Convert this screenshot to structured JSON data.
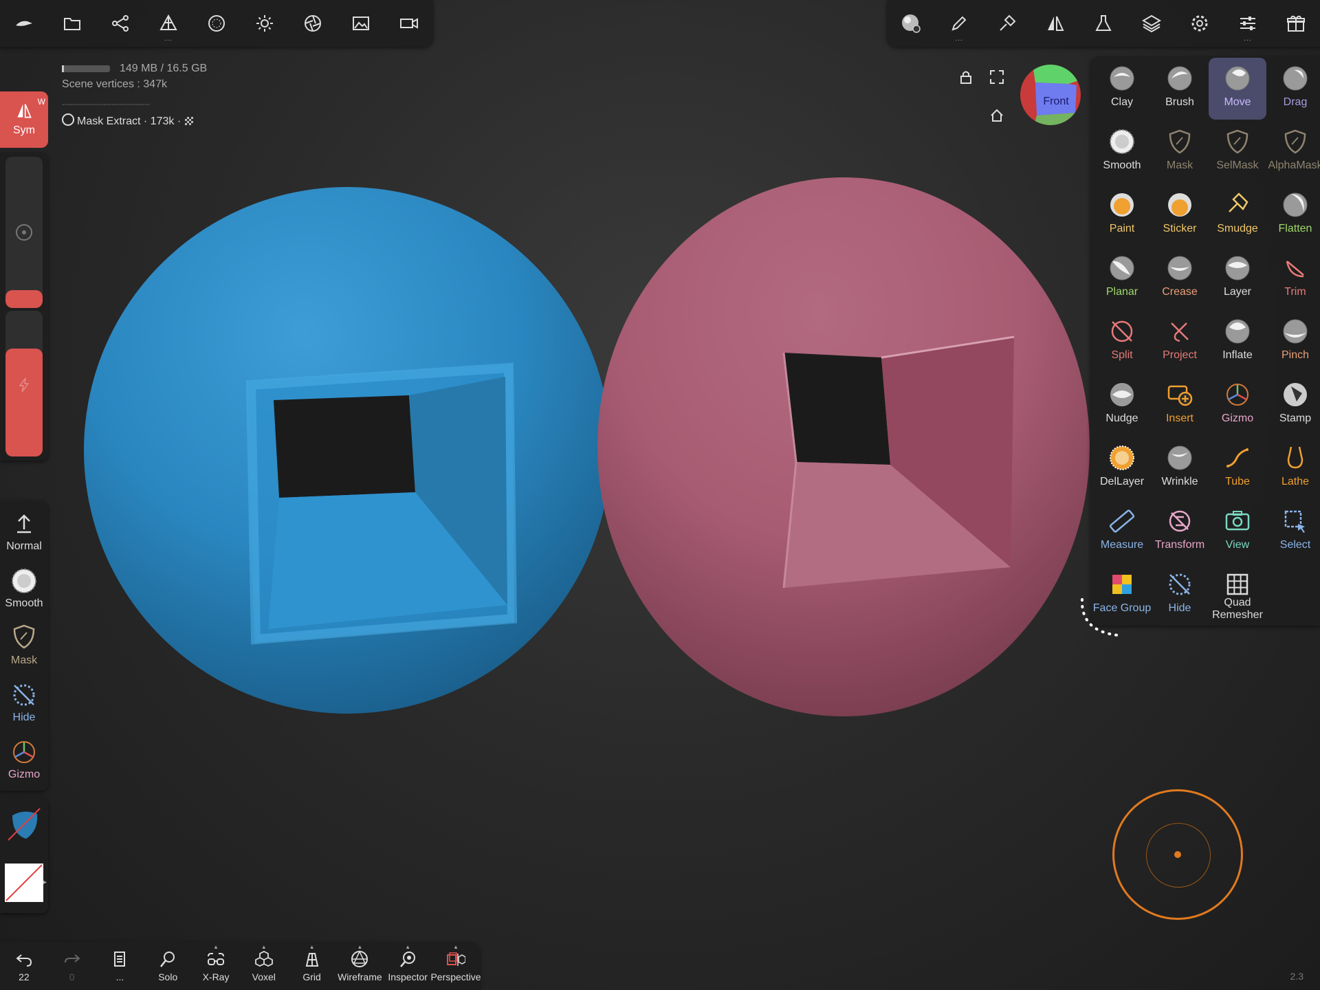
{
  "top_left_toolbar": [
    "app-logo-icon",
    "folder-icon",
    "scene-graph-icon",
    "topology-icon",
    "material-icon",
    "light-icon",
    "camera-icon",
    "image-icon",
    "video-icon"
  ],
  "top_right_toolbar": [
    "matcap-icon",
    "paint-brush-icon",
    "stroke-icon",
    "symmetry-icon",
    "flask-icon",
    "layers-icon",
    "settings-icon",
    "sliders-icon",
    "gift-icon"
  ],
  "info": {
    "memory": "149 MB / 16.5 GB",
    "vertices": "Scene vertices :  347k",
    "separator": "--------------------------------",
    "mask_extract": "Mask Extract · 173k ·"
  },
  "left_panel": {
    "sym_label": "Sym",
    "sym_shortcut": "W",
    "size_slider_fill": 0.12,
    "intensity_slider_fill": 0.74,
    "tools": [
      {
        "label": "Normal",
        "icon": "arrow-up-icon",
        "color": "#dddddd"
      },
      {
        "label": "Smooth",
        "icon": "smooth-icon",
        "color": "#dddddd"
      },
      {
        "label": "Mask",
        "icon": "mask-icon",
        "color": "#b8a98a"
      },
      {
        "label": "Hide",
        "icon": "hide-icon",
        "color": "#8ab4e8"
      },
      {
        "label": "Gizmo",
        "icon": "gizmo-icon",
        "color": "#e8a7c9"
      }
    ]
  },
  "view": {
    "cube_label": "Front",
    "version": "2.3"
  },
  "tools": [
    {
      "label": "Clay",
      "color": "#dddddd",
      "icon": "clay-icon",
      "active": false
    },
    {
      "label": "Brush",
      "color": "#dddddd",
      "icon": "brush-icon",
      "active": false
    },
    {
      "label": "Move",
      "color": "#c9b8ff",
      "icon": "move-icon",
      "active": true
    },
    {
      "label": "Drag",
      "color": "#a99ae0",
      "icon": "drag-icon",
      "active": false
    },
    {
      "label": "Smooth",
      "color": "#dddddd",
      "icon": "smooth-icon",
      "active": false
    },
    {
      "label": "Mask",
      "color": "#8f8470",
      "icon": "mask-icon",
      "active": false
    },
    {
      "label": "SelMask",
      "color": "#8f8470",
      "icon": "selmask-icon",
      "active": false
    },
    {
      "label": "AlphaMask",
      "color": "#8f8470",
      "icon": "alphamask-icon",
      "active": false
    },
    {
      "label": "Paint",
      "color": "#f0c86a",
      "icon": "paint-icon",
      "active": false
    },
    {
      "label": "Sticker",
      "color": "#f0c86a",
      "icon": "sticker-icon",
      "active": false
    },
    {
      "label": "Smudge",
      "color": "#f0c86a",
      "icon": "smudge-icon",
      "active": false
    },
    {
      "label": "Flatten",
      "color": "#9fd86a",
      "icon": "flatten-icon",
      "active": false
    },
    {
      "label": "Planar",
      "color": "#9fd86a",
      "icon": "planar-icon",
      "active": false
    },
    {
      "label": "Crease",
      "color": "#e8a07a",
      "icon": "crease-icon",
      "active": false
    },
    {
      "label": "Layer",
      "color": "#dddddd",
      "icon": "layer-icon",
      "active": false
    },
    {
      "label": "Trim",
      "color": "#e87a7a",
      "icon": "trim-icon",
      "active": false
    },
    {
      "label": "Split",
      "color": "#e87a7a",
      "icon": "split-icon",
      "active": false
    },
    {
      "label": "Project",
      "color": "#e87a7a",
      "icon": "project-icon",
      "active": false
    },
    {
      "label": "Inflate",
      "color": "#dddddd",
      "icon": "inflate-icon",
      "active": false
    },
    {
      "label": "Pinch",
      "color": "#e8a07a",
      "icon": "pinch-icon",
      "active": false
    },
    {
      "label": "Nudge",
      "color": "#dddddd",
      "icon": "nudge-icon",
      "active": false
    },
    {
      "label": "Insert",
      "color": "#f0a030",
      "icon": "insert-icon",
      "active": false
    },
    {
      "label": "Gizmo",
      "color": "#e8a7c9",
      "icon": "gizmo-icon",
      "active": false
    },
    {
      "label": "Stamp",
      "color": "#dddddd",
      "icon": "stamp-icon",
      "active": false
    },
    {
      "label": "DelLayer",
      "color": "#dddddd",
      "icon": "dellayer-icon",
      "active": false
    },
    {
      "label": "Wrinkle",
      "color": "#dddddd",
      "icon": "wrinkle-icon",
      "active": false
    },
    {
      "label": "Tube",
      "color": "#f0a030",
      "icon": "tube-icon",
      "active": false
    },
    {
      "label": "Lathe",
      "color": "#f0a030",
      "icon": "lathe-icon",
      "active": false
    },
    {
      "label": "Measure",
      "color": "#8ab4e8",
      "icon": "measure-icon",
      "active": false
    },
    {
      "label": "Transform",
      "color": "#e8a7c9",
      "icon": "transform-icon",
      "active": false
    },
    {
      "label": "View",
      "color": "#7ad8c0",
      "icon": "view-icon",
      "active": false
    },
    {
      "label": "Select",
      "color": "#8ab4e8",
      "icon": "select-icon",
      "active": false
    },
    {
      "label": "Face Group",
      "color": "#8ab4e8",
      "icon": "facegroup-icon",
      "active": false
    },
    {
      "label": "Hide",
      "color": "#8ab4e8",
      "icon": "hide-icon",
      "active": false
    },
    {
      "label": "Quad\nRemesher",
      "color": "#dddddd",
      "icon": "quad-remesher-icon",
      "active": false
    }
  ],
  "bottom_bar": [
    {
      "label": "22",
      "icon": "undo-icon"
    },
    {
      "label": "0",
      "icon": "redo-icon"
    },
    {
      "label": "...",
      "icon": "scene-list-icon"
    },
    {
      "label": "Solo",
      "icon": "solo-icon"
    },
    {
      "label": "X-Ray",
      "icon": "xray-icon"
    },
    {
      "label": "Voxel",
      "icon": "voxel-icon"
    },
    {
      "label": "Grid",
      "icon": "grid-icon"
    },
    {
      "label": "Wireframe",
      "icon": "wireframe-icon"
    },
    {
      "label": "Inspector",
      "icon": "inspector-icon"
    },
    {
      "label": "Perspective",
      "icon": "perspective-icon"
    }
  ]
}
